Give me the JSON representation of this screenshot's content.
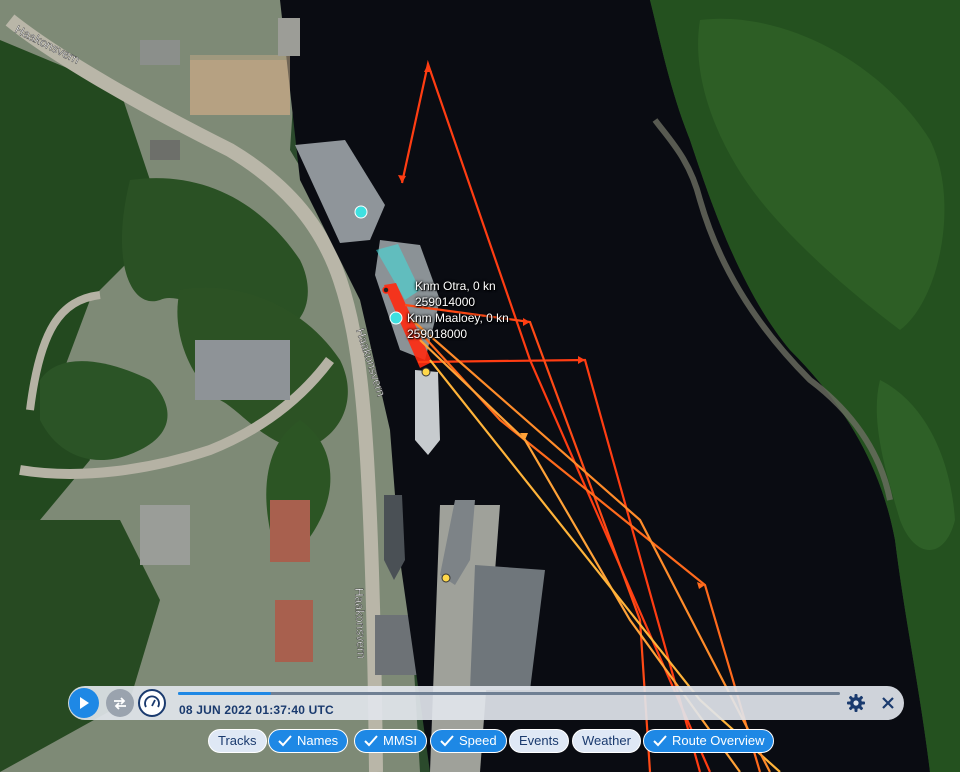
{
  "map": {
    "street_label_1": "Haakonsvern",
    "street_label_2": "Haakonsvern",
    "street_label_3": "Haakonsvern",
    "vessels": [
      {
        "name_speed": "Knm Otra, 0 kn",
        "mmsi": "259014000"
      },
      {
        "name_speed": "Knm Maaloey, 0 kn",
        "mmsi": "259018000"
      }
    ],
    "colors": {
      "water": "#0a0c12",
      "forest": "#1f4a21",
      "track_red": "#ff3d12",
      "track_orange": "#ff7a1a",
      "track_yellow": "#ffb43a",
      "vessel_marker": "#3fe0e0"
    }
  },
  "playback": {
    "play_icon": "play-icon",
    "loop_icon": "loop-icon",
    "speed_icon": "speedometer-icon",
    "timestamp": "08 JUN 2022 01:37:40 UTC",
    "progress": 0.14,
    "settings_icon": "gear-icon",
    "close_icon": "close-icon"
  },
  "toggles": {
    "tracks": "Tracks",
    "names": "Names",
    "mmsi": "MMSI",
    "speed": "Speed",
    "events": "Events",
    "weather": "Weather",
    "route_overview": "Route Overview"
  }
}
